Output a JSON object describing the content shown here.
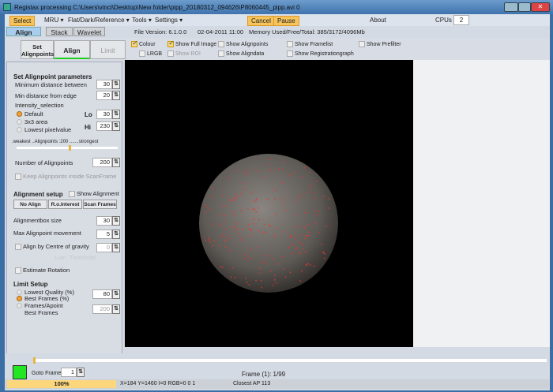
{
  "title": "Registax processing C:\\Users\\vinci\\Desktop\\New folder\\pipp_20180312_094626\\P8060445_pipp.avi 0",
  "menu": {
    "select": "Select",
    "mru": "MRU ▾",
    "flat": "Flat/Dark/Reference ▾",
    "tools": "Tools ▾",
    "settings": "Settings ▾",
    "cancel": "Cancel",
    "pause": "Pause",
    "about": "About",
    "cpus_label": "CPUs :",
    "cpus_value": "2"
  },
  "tabs": [
    "Align",
    "Stack",
    "Wavelet"
  ],
  "info": {
    "file_version": "File Version: 6.1.0.0",
    "date": "02-04-2011 11:00",
    "memory": "Memory Used/Free/Total: 385/3172/4096Mb"
  },
  "toolbar": {
    "set_alignpoints": "Set Alignpoints",
    "align": "Align",
    "limit": "Limit",
    "colour": "Colour",
    "show_full_image": "Show Full Image",
    "show_alignpoints": "Show Alignpoints",
    "show_framelist": "Show Framelist",
    "show_prefilter": "Show Prefilter",
    "lrgb": "LRGB",
    "show_roi": "Show ROI",
    "show_aligndata": "Show Aligndata",
    "show_registrationgraph": "Show Registrationgraph"
  },
  "left": {
    "set_ap_title": "Set Alignpoint parameters",
    "min_dist": "Minimum distance between",
    "min_dist_v": "30",
    "min_edge": "Min distance from edge",
    "min_edge_v": "20",
    "intensity": "Intensity_selection",
    "default": "Default",
    "area": "3x3 area",
    "lowest": "Lowest pixelvalue",
    "lo": "Lo",
    "lo_v": "30",
    "hi": "Hi",
    "hi_v": "230",
    "slider_text": ".weakest  ..Alignpoints :200  .......strongest",
    "num_ap": "Number of Alignpoints",
    "num_ap_v": "200",
    "keep": "Keep Alignpoints inside ScanFrame",
    "align_setup": "Alignment setup",
    "show_alignment": "Show Alignment",
    "no_align": "No Align",
    "roi": "R.o.Interest",
    "scan": "Scan Frames",
    "box": "Alignmentbox size",
    "box_v": "30",
    "max_move": "Max Alignpoint movement",
    "max_move_v": "5",
    "cog": "Align by Centre of gravity",
    "cog_v": "0",
    "lum": "Lum. Threshold",
    "rotation": "Estimate Rotation",
    "limit_setup": "Limit Setup",
    "lowest_q": "Lowest Quality (%)",
    "best_pct": "Best Frames (%)",
    "best_pct_v": "80",
    "frames_ap": "Frames/Apoint",
    "best_frames": "Best Frames",
    "best_frames_v": "200"
  },
  "bottom": {
    "goto": "Goto Frame",
    "goto_v": "1",
    "frame": "Frame (1): 1/99",
    "indicator_color": "#22e622"
  },
  "status": {
    "progress": "100%",
    "coords": "X=184 Y=1460 I=0 RGB=0 0 1",
    "closest": "Closest AP 113"
  }
}
